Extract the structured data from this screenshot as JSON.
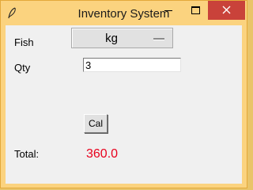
{
  "window": {
    "title": "Inventory System",
    "icon": "feather-icon",
    "controls": [
      "minimize-icon",
      "maximize-icon",
      "close-icon"
    ],
    "accent_color": "#fbd37f",
    "close_color": "#c9423a"
  },
  "form": {
    "fish_label": "Fish",
    "unit_selected": "kg",
    "qty_label": "Qty",
    "qty_value": "3",
    "calc_button": "Cal",
    "total_label": "Total:",
    "total_value": "360.0",
    "total_color": "#e8001c"
  }
}
